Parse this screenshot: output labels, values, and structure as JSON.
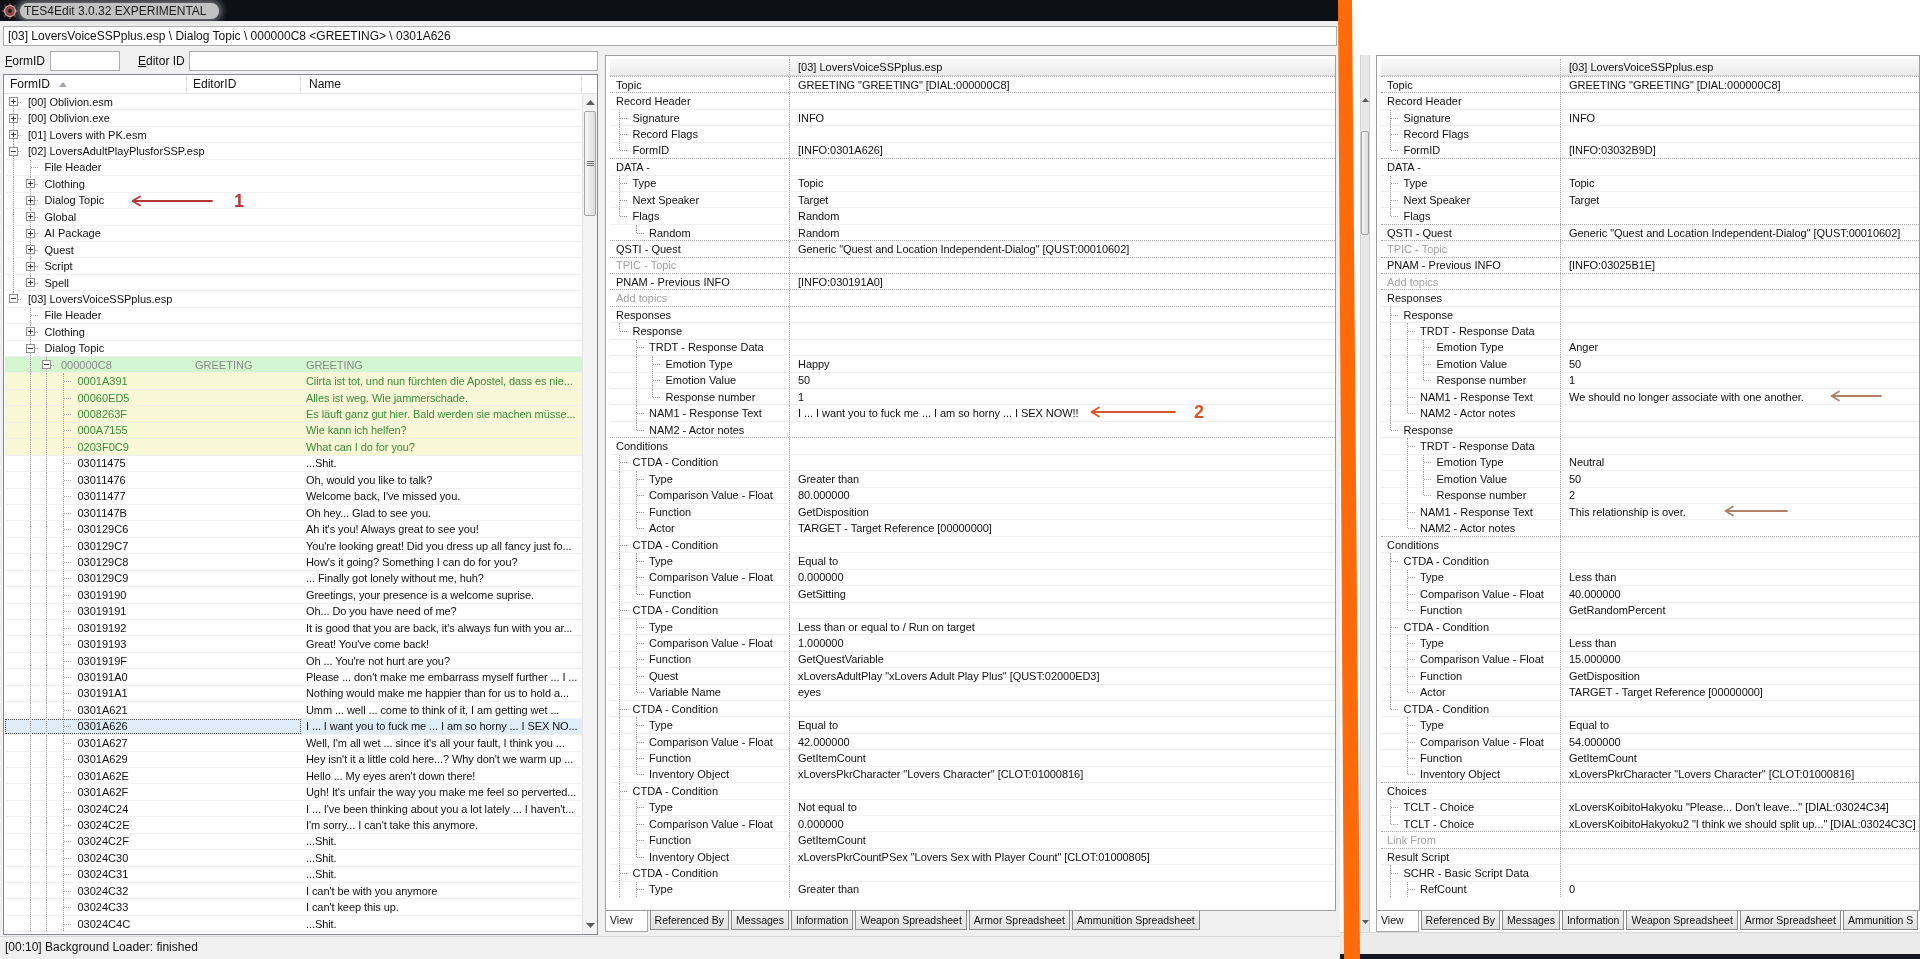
{
  "window": {
    "title": "TES4Edit 3.0.32 EXPERIMENTAL"
  },
  "path_bar": {
    "value": "[03] LoversVoiceSSPplus.esp \\ Dialog Topic \\ 000000C8 <GREETING> \\ 0301A626"
  },
  "filters": [
    {
      "label": "FormID"
    },
    {
      "label": "Editor ID"
    }
  ],
  "tree": {
    "columns": [
      {
        "label": "FormID",
        "sorted": true
      },
      {
        "label": "EditorID",
        "sorted": false
      },
      {
        "label": "Name",
        "sorted": false
      }
    ],
    "rows": [
      {
        "form_id": "[00] Oblivion.esm",
        "kind": "node",
        "expanded": false,
        "selected": false
      },
      {
        "form_id": "[00] Oblivion.exe",
        "kind": "node",
        "expanded": false,
        "selected": false
      },
      {
        "form_id": "[01] Lovers with PK.esm",
        "kind": "node",
        "expanded": false,
        "selected": false
      },
      {
        "form_id": "[02] LoversAdultPlayPlusforSSP.esp",
        "kind": "node",
        "expanded": true,
        "selected": false,
        "children": [
          {
            "form_id": "File Header",
            "kind": "leaf",
            "selected": false
          },
          {
            "form_id": "Clothing",
            "kind": "node",
            "expanded": false,
            "selected": false
          },
          {
            "form_id": "Dialog Topic",
            "kind": "node",
            "expanded": false,
            "selected": false
          },
          {
            "form_id": "Global",
            "kind": "node",
            "expanded": false,
            "selected": false
          },
          {
            "form_id": "AI Package",
            "kind": "node",
            "expanded": false,
            "selected": false
          },
          {
            "form_id": "Quest",
            "kind": "node",
            "expanded": false,
            "selected": false
          },
          {
            "form_id": "Script",
            "kind": "node",
            "expanded": false,
            "selected": false
          },
          {
            "form_id": "Spell",
            "kind": "node",
            "expanded": false,
            "selected": false
          }
        ]
      },
      {
        "form_id": "[03] LoversVoiceSSPplus.esp",
        "kind": "node",
        "expanded": true,
        "selected": false,
        "children": [
          {
            "form_id": "File Header",
            "kind": "leaf",
            "selected": false
          },
          {
            "form_id": "Clothing",
            "kind": "node",
            "expanded": false,
            "selected": false
          },
          {
            "form_id": "Dialog Topic",
            "kind": "node",
            "expanded": true,
            "selected": false,
            "children": [
              {
                "form_id": "000000C8",
                "editor_id": "GREETING",
                "name": "GREETING",
                "kind": "node",
                "expanded": true,
                "selected": false,
                "color": "#8a8a8a",
                "highlight": {
                  "color": "#d3f6d1"
                },
                "children": [
                  {
                    "form_id": "0001A391",
                    "name": "Ciirta ist tot, und nun fürchten die Apostel, dass es nie...",
                    "kind": "leaf",
                    "selected": false,
                    "color": "#3c8c3c",
                    "highlight": {
                      "color": "#f8f8d6"
                    }
                  },
                  {
                    "form_id": "00060ED5",
                    "name": "Alles ist weg. Wie jammerschade.",
                    "kind": "leaf",
                    "selected": false,
                    "color": "#3c8c3c",
                    "highlight": {
                      "color": "#f8f8d6"
                    }
                  },
                  {
                    "form_id": "0008263F",
                    "name": "Es läuft ganz gut hier. Bald werden sie machen müsse...",
                    "kind": "leaf",
                    "selected": false,
                    "color": "#3c8c3c",
                    "highlight": {
                      "color": "#f8f8d6"
                    }
                  },
                  {
                    "form_id": "000A7155",
                    "name": "Wie kann ich helfen?",
                    "kind": "leaf",
                    "selected": false,
                    "color": "#3c8c3c",
                    "highlight": {
                      "color": "#f8f8d6"
                    }
                  },
                  {
                    "form_id": "0203F0C9",
                    "name": "What can I do for you?",
                    "kind": "leaf",
                    "selected": false,
                    "color": "#3c8c3c",
                    "highlight": {
                      "color": "#f8f8d6"
                    }
                  },
                  {
                    "form_id": "03011475",
                    "name": "...Shit.",
                    "kind": "leaf",
                    "selected": false
                  },
                  {
                    "form_id": "03011476",
                    "name": "Oh, would you like to talk?",
                    "kind": "leaf",
                    "selected": false
                  },
                  {
                    "form_id": "03011477",
                    "name": "Welcome back, I've missed you.",
                    "kind": "leaf",
                    "selected": false
                  },
                  {
                    "form_id": "0301147B",
                    "name": "Oh hey... Glad to see you.",
                    "kind": "leaf",
                    "selected": false
                  },
                  {
                    "form_id": "030129C6",
                    "name": "Ah it's you! Always great to see you!",
                    "kind": "leaf",
                    "selected": false
                  },
                  {
                    "form_id": "030129C7",
                    "name": "You're looking great! Did you dress up all fancy just fo...",
                    "kind": "leaf",
                    "selected": false
                  },
                  {
                    "form_id": "030129C8",
                    "name": "How's it going? Something I can do for you?",
                    "kind": "leaf",
                    "selected": false
                  },
                  {
                    "form_id": "030129C9",
                    "name": "... Finally got lonely without me, huh?",
                    "kind": "leaf",
                    "selected": false
                  },
                  {
                    "form_id": "03019190",
                    "name": "Greetings, your presence is a welcome suprise.",
                    "kind": "leaf",
                    "selected": false
                  },
                  {
                    "form_id": "03019191",
                    "name": "Oh... Do you have need of me?",
                    "kind": "leaf",
                    "selected": false
                  },
                  {
                    "form_id": "03019192",
                    "name": "It is good that you are back, it's always fun with you ar...",
                    "kind": "leaf",
                    "selected": false
                  },
                  {
                    "form_id": "03019193",
                    "name": "Great!  You've come back!",
                    "kind": "leaf",
                    "selected": false
                  },
                  {
                    "form_id": "0301919F",
                    "name": "Oh ... You're not hurt are you?",
                    "kind": "leaf",
                    "selected": false
                  },
                  {
                    "form_id": "030191A0",
                    "name": "Please ... don't make me embarrass myself further ... I ...",
                    "kind": "leaf",
                    "selected": false
                  },
                  {
                    "form_id": "030191A1",
                    "name": "Nothing would make me happier than for us to hold a...",
                    "kind": "leaf",
                    "selected": false
                  },
                  {
                    "form_id": "0301A621",
                    "name": "Umm ... well ... come to think of it, I am getting wet ...",
                    "kind": "leaf",
                    "selected": false
                  },
                  {
                    "form_id": "0301A626",
                    "name": "I ... I want you to fuck me ... I am so horny ... I SEX NO...",
                    "kind": "leaf",
                    "selected": true
                  },
                  {
                    "form_id": "0301A627",
                    "name": "Well, I'm all wet ...  since it's all your fault, I think you ...",
                    "kind": "leaf",
                    "selected": false
                  },
                  {
                    "form_id": "0301A629",
                    "name": "Hey isn't it a little cold here...? Why don't we warm up ...",
                    "kind": "leaf",
                    "selected": false
                  },
                  {
                    "form_id": "0301A62E",
                    "name": "Hello ... My eyes aren't down there!",
                    "kind": "leaf",
                    "selected": false
                  },
                  {
                    "form_id": "0301A62F",
                    "name": "Ugh! It's unfair the way you make me feel so perverted...",
                    "kind": "leaf",
                    "selected": false
                  },
                  {
                    "form_id": "03024C24",
                    "name": "I ... I've been thinking about you a lot lately ... I haven't...",
                    "kind": "leaf",
                    "selected": false
                  },
                  {
                    "form_id": "03024C2E",
                    "name": "I'm sorry... I can't take this anymore.",
                    "kind": "leaf",
                    "selected": false
                  },
                  {
                    "form_id": "03024C2F",
                    "name": "...Shit.",
                    "kind": "leaf",
                    "selected": false
                  },
                  {
                    "form_id": "03024C30",
                    "name": "...Shit.",
                    "kind": "leaf",
                    "selected": false
                  },
                  {
                    "form_id": "03024C31",
                    "name": "...Shit.",
                    "kind": "leaf",
                    "selected": false
                  },
                  {
                    "form_id": "03024C32",
                    "name": "I can't be with you anymore",
                    "kind": "leaf",
                    "selected": false
                  },
                  {
                    "form_id": "03024C33",
                    "name": "I can't keep this up.",
                    "kind": "leaf",
                    "selected": false
                  },
                  {
                    "form_id": "03024C4C",
                    "name": "...Shit.",
                    "kind": "leaf",
                    "selected": false
                  }
                ]
              }
            ]
          }
        ]
      }
    ]
  },
  "status_bar": {
    "text": "[00:10] Background Loader: finished"
  },
  "record_views": [
    {
      "header": "[03] LoversVoiceSSPplus.esp",
      "rows": [
        {
          "label": "Topic",
          "value": "GREETING \"GREETING\" [DIAL:000000C8]",
          "disabled": false
        },
        {
          "label": "Record Header",
          "disabled": false,
          "children": [
            {
              "label": "Signature",
              "value": "INFO"
            },
            {
              "label": "Record Flags"
            },
            {
              "label": "FormID",
              "value": "[INFO:0301A626]"
            }
          ]
        },
        {
          "label": "DATA -",
          "disabled": false,
          "children": [
            {
              "label": "Type",
              "value": "Topic"
            },
            {
              "label": "Next Speaker",
              "value": "Target"
            },
            {
              "label": "Flags",
              "value": "Random",
              "children": [
                {
                  "label": "Random",
                  "value": "Random"
                }
              ]
            }
          ]
        },
        {
          "label": "QSTI - Quest",
          "value": "Generic \"Quest and Location Independent-Dialog\" [QUST:00010602]",
          "disabled": false
        },
        {
          "label": "TPIC - Topic",
          "disabled": true
        },
        {
          "label": "PNAM - Previous INFO",
          "value": "[INFO:030191A0]",
          "disabled": false
        },
        {
          "label": "Add topics",
          "disabled": true
        },
        {
          "label": "Responses",
          "disabled": false,
          "children": [
            {
              "label": "Response",
              "children": [
                {
                  "label": "TRDT - Response Data",
                  "children": [
                    {
                      "label": "Emotion Type",
                      "value": "Happy"
                    },
                    {
                      "label": "Emotion Value",
                      "value": "50"
                    },
                    {
                      "label": "Response number",
                      "value": "1"
                    }
                  ]
                },
                {
                  "label": "NAM1 - Response Text",
                  "value": "I ... I want you to fuck me ... I am so horny ... I SEX NOW!!"
                },
                {
                  "label": "NAM2 - Actor notes"
                }
              ]
            }
          ]
        },
        {
          "label": "Conditions",
          "disabled": false,
          "children": [
            {
              "label": "CTDA - Condition",
              "children": [
                {
                  "label": "Type",
                  "value": "Greater than"
                },
                {
                  "label": "Comparison Value - Float",
                  "value": "80.000000"
                },
                {
                  "label": "Function",
                  "value": "GetDisposition"
                },
                {
                  "label": "Actor",
                  "value": "TARGET - Target Reference [00000000]"
                }
              ]
            },
            {
              "label": "CTDA - Condition",
              "children": [
                {
                  "label": "Type",
                  "value": "Equal to"
                },
                {
                  "label": "Comparison Value - Float",
                  "value": "0.000000"
                },
                {
                  "label": "Function",
                  "value": "GetSitting"
                }
              ]
            },
            {
              "label": "CTDA - Condition",
              "children": [
                {
                  "label": "Type",
                  "value": "Less than or equal to / Run on target"
                },
                {
                  "label": "Comparison Value - Float",
                  "value": "1.000000"
                },
                {
                  "label": "Function",
                  "value": "GetQuestVariable"
                },
                {
                  "label": "Quest",
                  "value": "xLoversAdultPlay \"xLovers Adult Play Plus\" [QUST:02000ED3]"
                },
                {
                  "label": "Variable Name",
                  "value": "eyes"
                }
              ]
            },
            {
              "label": "CTDA - Condition",
              "children": [
                {
                  "label": "Type",
                  "value": "Equal to"
                },
                {
                  "label": "Comparison Value - Float",
                  "value": "42.000000"
                },
                {
                  "label": "Function",
                  "value": "GetItemCount"
                },
                {
                  "label": "Inventory Object",
                  "value": "xLoversPkrCharacter \"Lovers Character\" [CLOT:01000816]"
                }
              ]
            },
            {
              "label": "CTDA - Condition",
              "children": [
                {
                  "label": "Type",
                  "value": "Not equal to"
                },
                {
                  "label": "Comparison Value - Float",
                  "value": "0.000000"
                },
                {
                  "label": "Function",
                  "value": "GetItemCount"
                },
                {
                  "label": "Inventory Object",
                  "value": "xLoversPkrCountPSex \"Lovers Sex with Player Count\" [CLOT:01000805]"
                }
              ]
            },
            {
              "label": "CTDA - Condition",
              "children": [
                {
                  "label": "Type",
                  "value": "Greater than"
                }
              ]
            }
          ]
        }
      ],
      "tabs": [
        {
          "label": "View",
          "selected": true
        },
        {
          "label": "Referenced By",
          "selected": false
        },
        {
          "label": "Messages",
          "selected": false
        },
        {
          "label": "Information",
          "selected": false
        },
        {
          "label": "Weapon Spreadsheet",
          "selected": false
        },
        {
          "label": "Armor Spreadsheet",
          "selected": false
        },
        {
          "label": "Ammunition Spreadsheet",
          "selected": false
        }
      ]
    },
    {
      "header": "[03] LoversVoiceSSPplus.esp",
      "rows": [
        {
          "label": "Topic",
          "value": "GREETING \"GREETING\" [DIAL:000000C8]",
          "disabled": false
        },
        {
          "label": "Record Header",
          "disabled": false,
          "children": [
            {
              "label": "Signature",
              "value": "INFO"
            },
            {
              "label": "Record Flags"
            },
            {
              "label": "FormID",
              "value": "[INFO:03032B9D]"
            }
          ]
        },
        {
          "label": "DATA -",
          "disabled": false,
          "children": [
            {
              "label": "Type",
              "value": "Topic"
            },
            {
              "label": "Next Speaker",
              "value": "Target"
            },
            {
              "label": "Flags"
            }
          ]
        },
        {
          "label": "QSTI - Quest",
          "value": "Generic \"Quest and Location Independent-Dialog\" [QUST:00010602]",
          "disabled": false
        },
        {
          "label": "TPIC - Topic",
          "disabled": true
        },
        {
          "label": "PNAM - Previous INFO",
          "value": "[INFO:03025B1E]",
          "disabled": false
        },
        {
          "label": "Add topics",
          "disabled": true
        },
        {
          "label": "Responses",
          "disabled": false,
          "children": [
            {
              "label": "Response",
              "children": [
                {
                  "label": "TRDT - Response Data",
                  "children": [
                    {
                      "label": "Emotion Type",
                      "value": "Anger"
                    },
                    {
                      "label": "Emotion Value",
                      "value": "50"
                    },
                    {
                      "label": "Response number",
                      "value": "1"
                    }
                  ]
                },
                {
                  "label": "NAM1 - Response Text",
                  "value": "We should no longer associate with one another."
                },
                {
                  "label": "NAM2 - Actor notes"
                }
              ]
            },
            {
              "label": "Response",
              "children": [
                {
                  "label": "TRDT - Response Data",
                  "children": [
                    {
                      "label": "Emotion Type",
                      "value": "Neutral"
                    },
                    {
                      "label": "Emotion Value",
                      "value": "50"
                    },
                    {
                      "label": "Response number",
                      "value": "2"
                    }
                  ]
                },
                {
                  "label": "NAM1 - Response Text",
                  "value": "This relationship is over."
                },
                {
                  "label": "NAM2 - Actor notes"
                }
              ]
            }
          ]
        },
        {
          "label": "Conditions",
          "disabled": false,
          "children": [
            {
              "label": "CTDA - Condition",
              "children": [
                {
                  "label": "Type",
                  "value": "Less than"
                },
                {
                  "label": "Comparison Value - Float",
                  "value": "40.000000"
                },
                {
                  "label": "Function",
                  "value": "GetRandomPercent"
                }
              ]
            },
            {
              "label": "CTDA - Condition",
              "children": [
                {
                  "label": "Type",
                  "value": "Less than"
                },
                {
                  "label": "Comparison Value - Float",
                  "value": "15.000000"
                },
                {
                  "label": "Function",
                  "value": "GetDisposition"
                },
                {
                  "label": "Actor",
                  "value": "TARGET - Target Reference [00000000]"
                }
              ]
            },
            {
              "label": "CTDA - Condition",
              "children": [
                {
                  "label": "Type",
                  "value": "Equal to"
                },
                {
                  "label": "Comparison Value - Float",
                  "value": "54.000000"
                },
                {
                  "label": "Function",
                  "value": "GetItemCount"
                },
                {
                  "label": "Inventory Object",
                  "value": "xLoversPkrCharacter \"Lovers Character\" [CLOT:01000816]"
                }
              ]
            }
          ]
        },
        {
          "label": "Choices",
          "disabled": false,
          "children": [
            {
              "label": "TCLT - Choice",
              "value": "xLoversKoibitoHakyoku \"Please... Don't leave...\" [DIAL:03024C34]"
            },
            {
              "label": "TCLT - Choice",
              "value": "xLoversKoibitoHakyoku2 \"I think we should split up...\" [DIAL:03024C3C]"
            }
          ]
        },
        {
          "label": "Link From",
          "disabled": true
        },
        {
          "label": "Result Script",
          "disabled": false,
          "children": [
            {
              "label": "SCHR - Basic Script Data",
              "children": [
                {
                  "label": "RefCount",
                  "value": "0"
                }
              ]
            }
          ]
        }
      ],
      "tabs": [
        {
          "label": "View",
          "selected": true
        },
        {
          "label": "Referenced By",
          "selected": false
        },
        {
          "label": "Messages",
          "selected": false
        },
        {
          "label": "Information",
          "selected": false
        },
        {
          "label": "Weapon Spreadsheet",
          "selected": false
        },
        {
          "label": "Armor Spreadsheet",
          "selected": false
        },
        {
          "label": "Ammunition S",
          "selected": false
        }
      ]
    }
  ],
  "annotations": [
    {
      "kind": "arrow",
      "label": "1",
      "color": "#b8383a"
    },
    {
      "kind": "arrow",
      "label": "2",
      "color": "#d9542a"
    },
    {
      "kind": "arrow",
      "color": "#b0826a"
    },
    {
      "kind": "arrow",
      "color": "#b0826a"
    },
    {
      "kind": "stroke",
      "color": "#ff6a0a"
    }
  ]
}
